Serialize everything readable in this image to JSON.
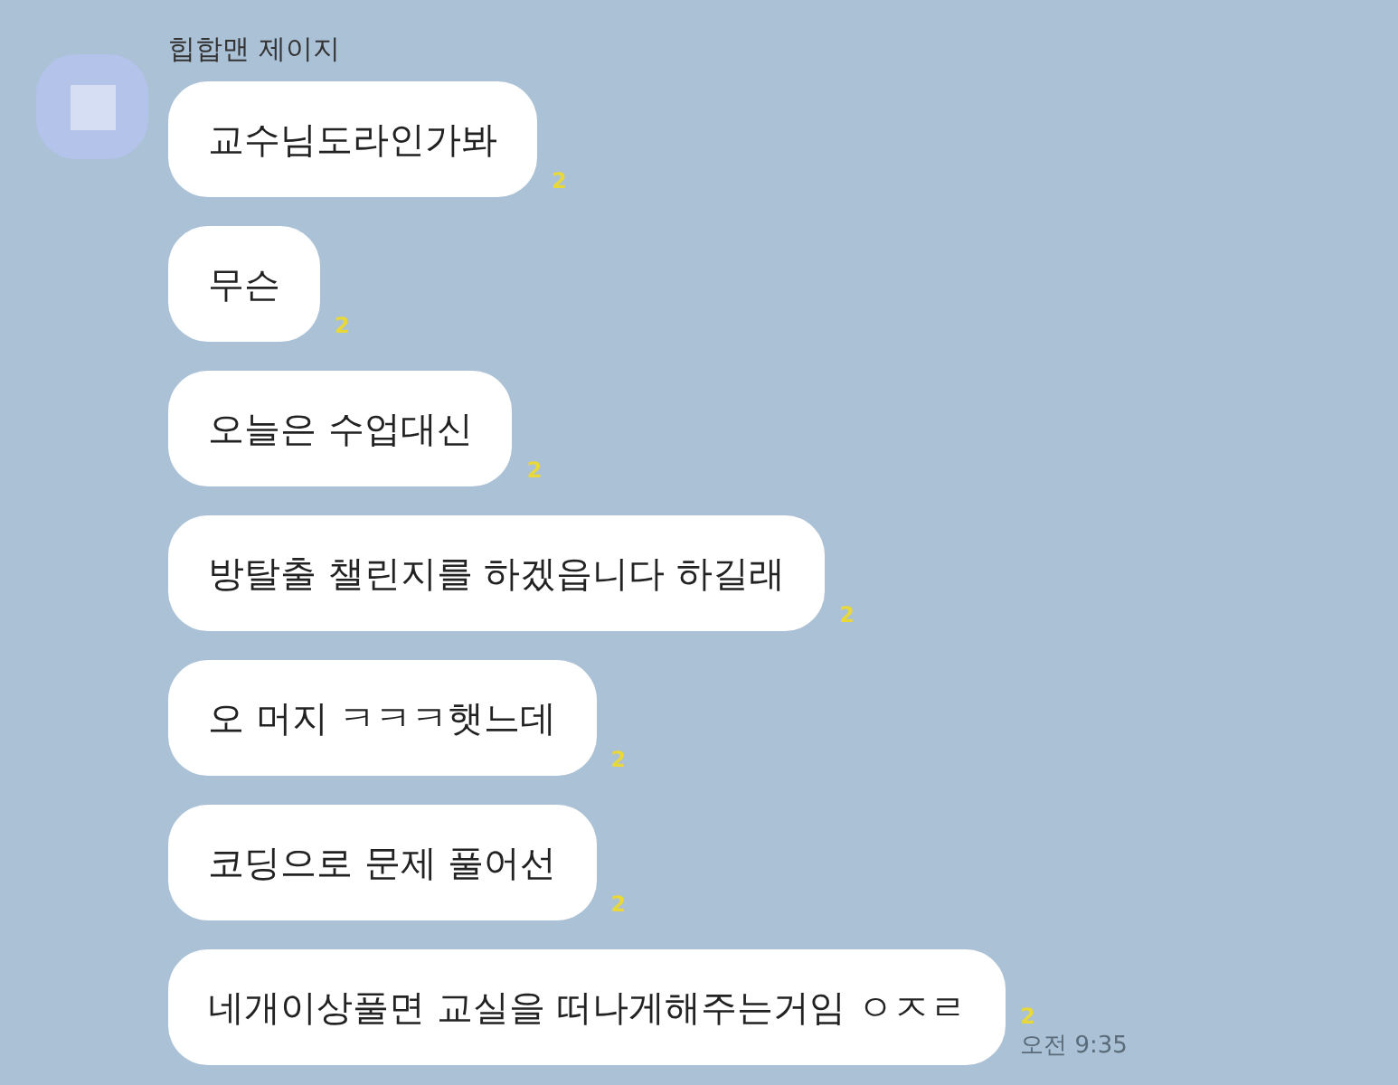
{
  "sender": {
    "name": "힙합맨 제이지"
  },
  "messages": [
    {
      "text": "교수님도라인가봐",
      "unread": "2"
    },
    {
      "text": "무슨",
      "unread": "2"
    },
    {
      "text": "오늘은 수업대신",
      "unread": "2"
    },
    {
      "text": "방탈출 챌린지를 하겠읍니다 하길래",
      "unread": "2"
    },
    {
      "text": "오 머지 ㅋㅋㅋ햇느데",
      "unread": "2"
    },
    {
      "text": "코딩으로 문제 풀어선",
      "unread": "2"
    },
    {
      "text": "네개이상풀면 교실을 떠나게해주는거임 ㅇㅈㄹ",
      "unread": "2",
      "time": "오전 9:35"
    }
  ]
}
